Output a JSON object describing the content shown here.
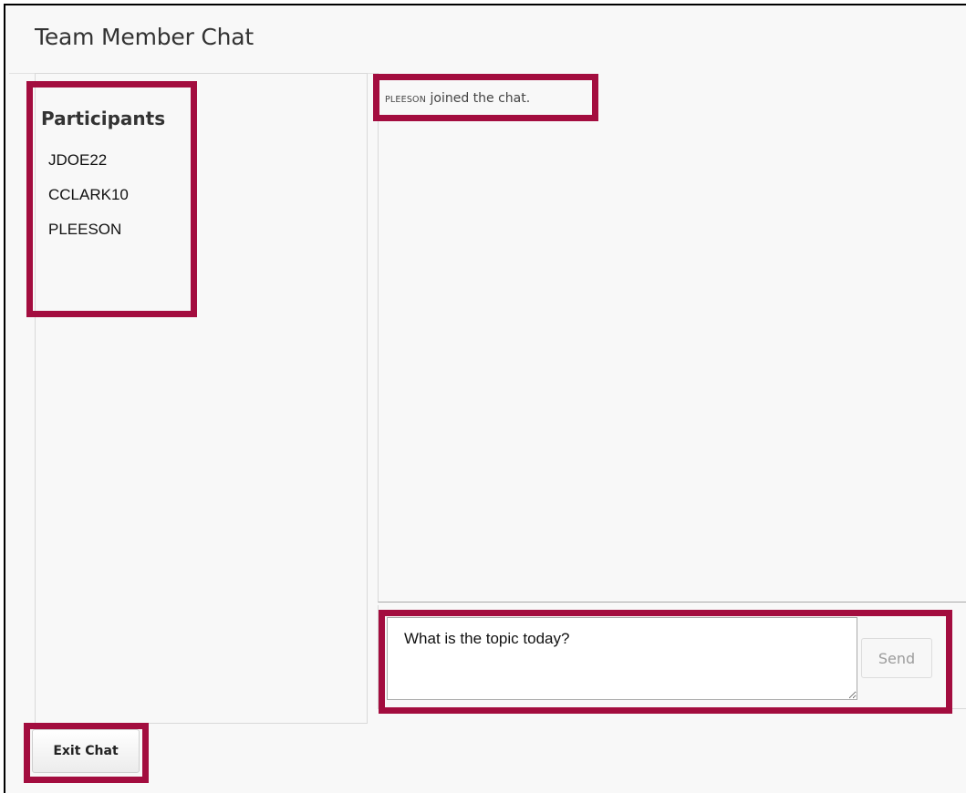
{
  "window": {
    "title": "Team Member Chat"
  },
  "participants": {
    "heading": "Participants",
    "items": [
      {
        "name": "JDOE22"
      },
      {
        "name": "CCLARK10"
      },
      {
        "name": "PLEESON"
      }
    ]
  },
  "chat": {
    "messages": [
      {
        "user": "PLEESON",
        "text": " joined the chat."
      }
    ]
  },
  "composer": {
    "input_value": "What is the topic today?",
    "send_label": "Send"
  },
  "footer": {
    "exit_label": "Exit Chat"
  },
  "colors": {
    "highlight": "#a30d3f",
    "background": "#f8f8f8"
  }
}
